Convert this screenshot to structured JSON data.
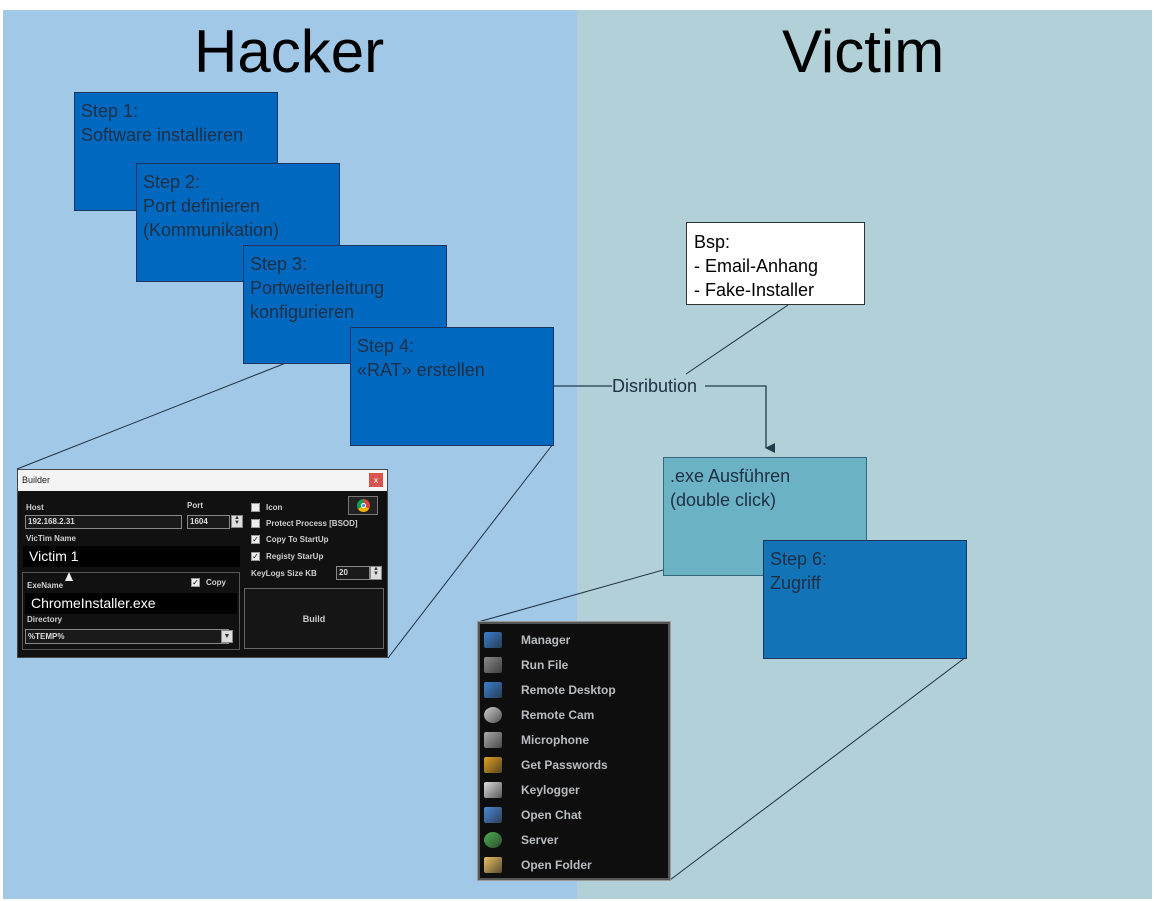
{
  "columns": {
    "left_title": "Hacker",
    "right_title": "Victim"
  },
  "steps": [
    {
      "label": "Step 1:\nSoftware installieren"
    },
    {
      "label": "Step 2:\nPort definieren\n(Kommunikation)"
    },
    {
      "label": "Step 3:\nPortweiterleitung\nkonfigurieren"
    },
    {
      "label": "Step 4:\n«RAT» erstellen"
    },
    {
      "label": ".exe Ausführen\n(double click)"
    },
    {
      "label": "Step 6:\nZugriff"
    }
  ],
  "example_note": "Bsp:\n- Email-Anhang\n- Fake-Installer",
  "distribution_label": "Disribution",
  "builder": {
    "title": "Builder",
    "close": "x",
    "host_label": "Host",
    "host_value": "192.168.2.31",
    "port_label": "Port",
    "port_value": "1604",
    "victim_name_label": "VicTim Name",
    "victim_name_value": "Victim 1",
    "exe_name_label": "ExeName",
    "copy_label": "Copy",
    "exe_name_value": "ChromeInstaller.exe",
    "directory_label": "Directory",
    "directory_value": "%TEMP%",
    "icon_label": "Icon",
    "protect_label": "Protect Process [BSOD]",
    "startup_label": "Copy To StartUp",
    "registry_label": "Registy StarUp",
    "keylog_label": "KeyLogs Size KB",
    "keylog_value": "20",
    "build_label": "Build",
    "checks": {
      "icon": false,
      "protect": false,
      "startup": true,
      "registry": true,
      "copy": true
    }
  },
  "rat_menu": {
    "items": [
      {
        "label": "Manager",
        "icon": "monitor-icon",
        "color": "#3a7fd0"
      },
      {
        "label": "Run File",
        "icon": "window-icon",
        "color": "#8a8a8a"
      },
      {
        "label": "Remote Desktop",
        "icon": "desktop-icon",
        "color": "#3a7fd0"
      },
      {
        "label": "Remote Cam",
        "icon": "webcam-icon",
        "color": "#cccccc"
      },
      {
        "label": "Microphone",
        "icon": "microphone-icon",
        "color": "#aaaaaa"
      },
      {
        "label": "Get Passwords",
        "icon": "key-icon",
        "color": "#e0a020"
      },
      {
        "label": "Keylogger",
        "icon": "keyboard-icon",
        "color": "#dddddd"
      },
      {
        "label": "Open Chat",
        "icon": "chat-icon",
        "color": "#4a8ad8"
      },
      {
        "label": "Server",
        "icon": "bug-icon",
        "color": "#4caf50"
      },
      {
        "label": "Open Folder",
        "icon": "folder-icon",
        "color": "#e8c060"
      }
    ]
  }
}
